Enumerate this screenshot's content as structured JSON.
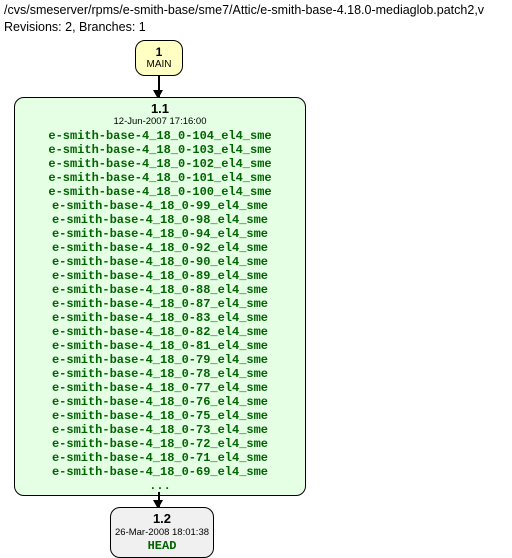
{
  "header": {
    "path": "/cvs/smeserver/rpms/e-smith-base/sme7/Attic/e-smith-base-4.18.0-mediaglob.patch2,v",
    "meta": "Revisions: 2, Branches: 1"
  },
  "main": {
    "num": "1",
    "label": "MAIN"
  },
  "rev1": {
    "version": "1.1",
    "timestamp": "12-Jun-2007 17:16:00",
    "tags": [
      "e-smith-base-4_18_0-104_el4_sme",
      "e-smith-base-4_18_0-103_el4_sme",
      "e-smith-base-4_18_0-102_el4_sme",
      "e-smith-base-4_18_0-101_el4_sme",
      "e-smith-base-4_18_0-100_el4_sme",
      "e-smith-base-4_18_0-99_el4_sme",
      "e-smith-base-4_18_0-98_el4_sme",
      "e-smith-base-4_18_0-94_el4_sme",
      "e-smith-base-4_18_0-92_el4_sme",
      "e-smith-base-4_18_0-90_el4_sme",
      "e-smith-base-4_18_0-89_el4_sme",
      "e-smith-base-4_18_0-88_el4_sme",
      "e-smith-base-4_18_0-87_el4_sme",
      "e-smith-base-4_18_0-83_el4_sme",
      "e-smith-base-4_18_0-82_el4_sme",
      "e-smith-base-4_18_0-81_el4_sme",
      "e-smith-base-4_18_0-79_el4_sme",
      "e-smith-base-4_18_0-78_el4_sme",
      "e-smith-base-4_18_0-77_el4_sme",
      "e-smith-base-4_18_0-76_el4_sme",
      "e-smith-base-4_18_0-75_el4_sme",
      "e-smith-base-4_18_0-73_el4_sme",
      "e-smith-base-4_18_0-72_el4_sme",
      "e-smith-base-4_18_0-71_el4_sme",
      "e-smith-base-4_18_0-69_el4_sme"
    ],
    "ellipsis": "..."
  },
  "rev2": {
    "version": "1.2",
    "timestamp": "26-Mar-2008 18:01:38",
    "head": "HEAD"
  }
}
